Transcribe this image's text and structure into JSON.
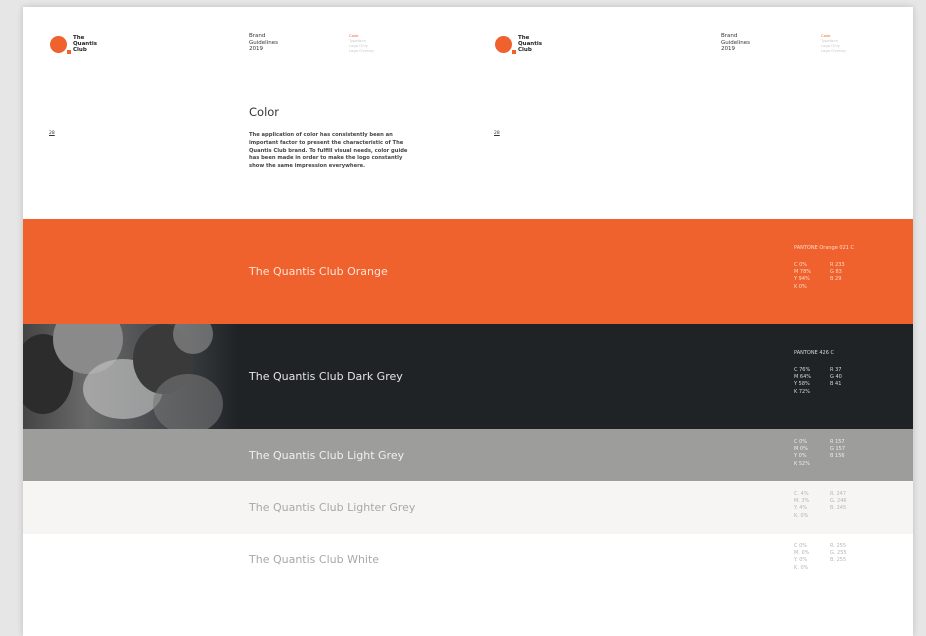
{
  "header": {
    "logo_text": [
      "The",
      "Quantis",
      "Club"
    ],
    "meta_lines": [
      "Brand",
      "Guidelines",
      "2019"
    ],
    "nav_items": [
      "Color",
      "Typeface",
      "Logo Only",
      "Logo Overlay"
    ],
    "page_marker": "28"
  },
  "section": {
    "title": "Color",
    "description": "The application of color has consistently been an important factor to present the characteristic of The Quantis Club brand. To fulfill visual needs, color guide has been made in order to make the logo constantly show the same impression everywhere."
  },
  "swatches": [
    {
      "name": "The Quantis Club Orange",
      "pantone": "PANTONE Orange 021 C",
      "cmyk": [
        "C  0%",
        "M  78%",
        "Y  94%",
        "K  0%"
      ],
      "rgb": [
        "R  233",
        "G  83",
        "B  29"
      ],
      "bg": "#f0622d",
      "name_color": "#ffe3d6",
      "spec_color": "#ffd9c8"
    },
    {
      "name": "The Quantis Club Dark Grey",
      "pantone": "PANTONE 426 C",
      "cmyk": [
        "C  76%",
        "M  64%",
        "Y  58%",
        "K  72%"
      ],
      "rgb": [
        "R  37",
        "G  40",
        "B  41"
      ],
      "bg": "#1f2326",
      "name_color": "#e6e6e6",
      "spec_color": "#d9d9d9"
    },
    {
      "name": "The Quantis Club Light Grey",
      "pantone": "",
      "cmyk": [
        "C  0%",
        "M  0%",
        "Y  0%",
        "K  52%"
      ],
      "rgb": [
        "R  157",
        "G  157",
        "B  156"
      ],
      "bg": "#9d9d9c",
      "name_color": "#f0f0f0",
      "spec_color": "#ececec"
    },
    {
      "name": "The Quantis Club Lighter Grey",
      "pantone": "",
      "cmyk": [
        "C. 4%",
        "M. 3%",
        "Y. 4%",
        "K. 0%"
      ],
      "rgb": [
        "R. 247",
        "G. 246",
        "B. 245"
      ],
      "bg": "#f6f5f3",
      "name_color": "#a8a8a8",
      "spec_color": "#b5b5b5"
    },
    {
      "name": "The Quantis Club White",
      "pantone": "",
      "cmyk": [
        "C  0%",
        "M. 0%",
        "Y. 0%",
        "K. 0%"
      ],
      "rgb": [
        "R. 255",
        "G. 255",
        "B. 255"
      ],
      "bg": "#ffffff",
      "name_color": "#a8a8a8",
      "spec_color": "#b5b5b5"
    }
  ]
}
